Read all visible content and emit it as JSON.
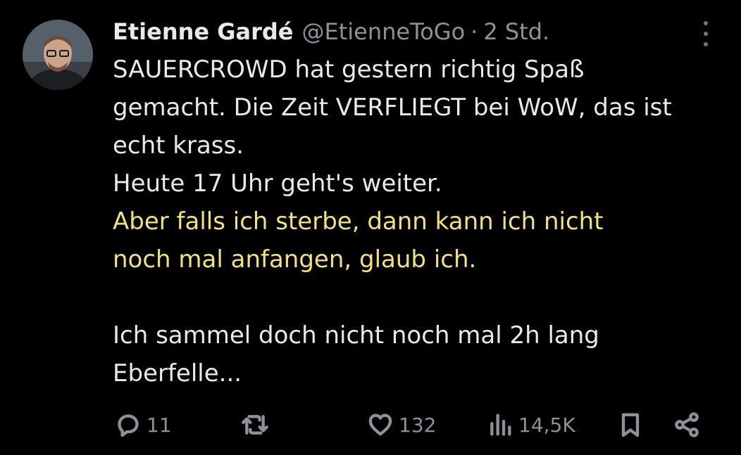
{
  "tweet": {
    "author": {
      "display_name": "Etienne Gardé",
      "handle": "@EtienneToGo",
      "separator": "·",
      "time": "2 Std."
    },
    "more_icon": "more-vertical-icon",
    "text_lines": {
      "l1": "SAUERCROWD hat gestern richtig Spaß",
      "l2": "gemacht. Die Zeit VERFLIEGT bei WoW, das ist",
      "l3": "echt krass.",
      "l4": "Heute 17 Uhr geht's weiter.",
      "l5": "Aber falls ich sterbe, dann kann ich nicht",
      "l6": "noch mal anfangen, glaub ich.",
      "l7": "Ich sammel doch nicht noch mal 2h lang",
      "l8": "Eberfelle..."
    },
    "actions": {
      "reply": {
        "icon": "reply-icon",
        "count": "11"
      },
      "retweet": {
        "icon": "retweet-icon",
        "count": ""
      },
      "like": {
        "icon": "heart-icon",
        "count": "132"
      },
      "views": {
        "icon": "views-icon",
        "count": "14,5K"
      },
      "bookmark": {
        "icon": "bookmark-icon"
      },
      "share": {
        "icon": "share-icon"
      }
    },
    "colors": {
      "background": "#000000",
      "text": "#e7e9ea",
      "secondary": "#8b9299",
      "highlight": "#f2e27a"
    }
  }
}
